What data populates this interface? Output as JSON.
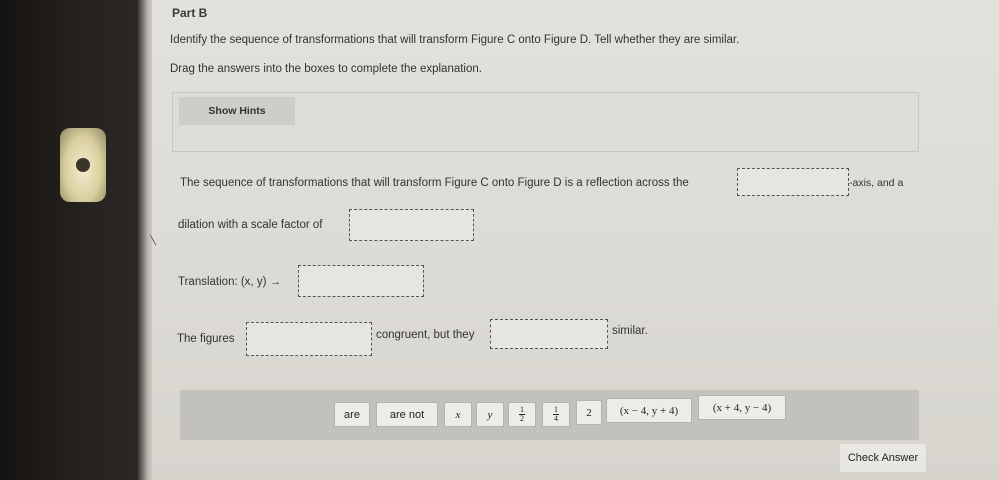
{
  "question": {
    "part_title": "Part B",
    "instruction_1": "Identify the sequence of transformations that will transform Figure C onto Figure D. Tell whether they are similar.",
    "instruction_2": "Drag the answers into the boxes to complete the explanation."
  },
  "hints": {
    "button_label": "Show Hints"
  },
  "explanation": {
    "line1_text": "The sequence of transformations that will transform Figure C onto Figure D is a reflection across the",
    "line1_suffix": "-axis, and a",
    "line2_text": "dilation with a scale factor of",
    "line3_text": "Translation: (x, y) →",
    "line4_prefix": "The figures",
    "line4_middle": "congruent, but they",
    "line4_suffix": "similar."
  },
  "answer_tiles": [
    {
      "label": "are"
    },
    {
      "label": "are not"
    },
    {
      "label": "x"
    },
    {
      "label": "y"
    },
    {
      "label": "1/2",
      "num": "1",
      "den": "2"
    },
    {
      "label": "1/4",
      "num": "1",
      "den": "4"
    },
    {
      "label": "2"
    },
    {
      "label": "(x − 4, y + 4)"
    },
    {
      "label": "(x + 4, y − 4)"
    }
  ],
  "actions": {
    "check_answer_label": "Check Answer"
  }
}
